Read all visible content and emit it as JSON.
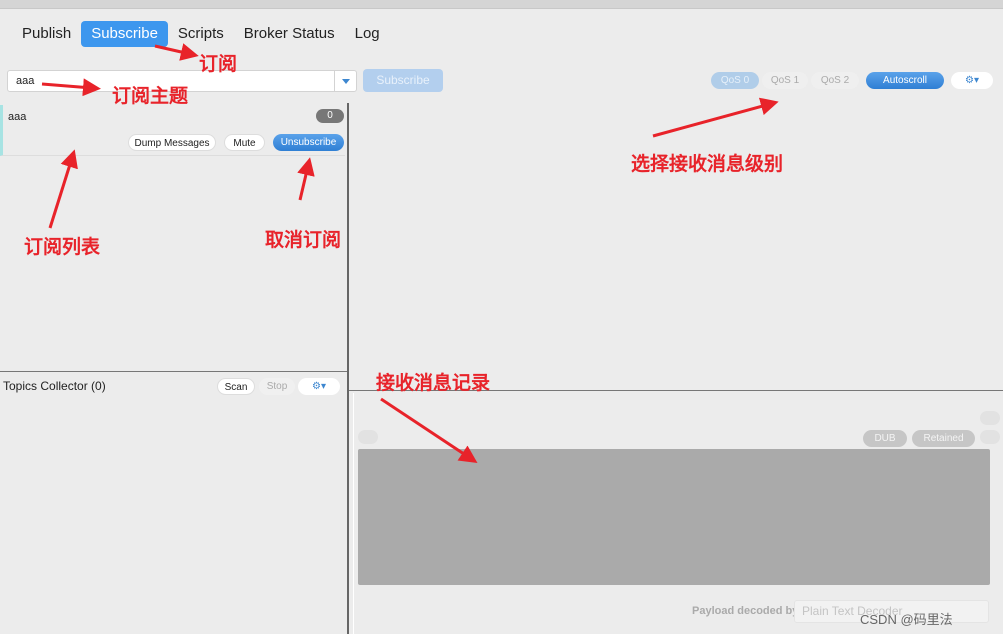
{
  "tabs": [
    {
      "label": "Publish",
      "active": false
    },
    {
      "label": "Subscribe",
      "active": true
    },
    {
      "label": "Scripts",
      "active": false
    },
    {
      "label": "Broker Status",
      "active": false
    },
    {
      "label": "Log",
      "active": false
    }
  ],
  "subscribe_bar": {
    "topic_value": "aaa",
    "subscribe_label": "Subscribe",
    "qos": [
      "QoS 0",
      "QoS 1",
      "QoS 2"
    ],
    "selected_qos": "QoS 0",
    "autoscroll_label": "Autoscroll",
    "settings_icon": "gear-dropdown-icon"
  },
  "subscriptions": [
    {
      "topic": "aaa",
      "count": "0",
      "dump_label": "Dump Messages",
      "mute_label": "Mute",
      "unsubscribe_label": "Unsubscribe"
    }
  ],
  "topics_collector": {
    "title": "Topics Collector (0)",
    "scan_label": "Scan",
    "stop_label": "Stop"
  },
  "message_view": {
    "dub_label": "DUB",
    "retained_label": "Retained",
    "payload_decoded_label": "Payload decoded by",
    "decoder_value": "Plain Text Decoder"
  },
  "annotations": {
    "subscribe": "订阅",
    "topic": "订阅主题",
    "qos_level": "选择接收消息级别",
    "sub_list": "订阅列表",
    "unsubscribe": "取消订阅",
    "messages": "接收消息记录"
  },
  "colors": {
    "accent": "#3d97ee",
    "annotation": "#e8232a"
  },
  "watermark": "CSDN @码里法"
}
